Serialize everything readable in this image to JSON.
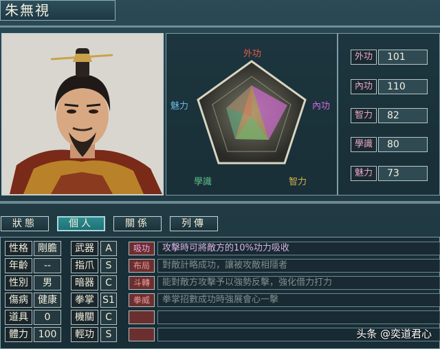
{
  "character": {
    "name": "朱無視"
  },
  "radar": {
    "axes": [
      "外功",
      "內功",
      "智力",
      "學識",
      "魅力"
    ],
    "axis_colors": [
      "#e85a4a",
      "#d56be0",
      "#d6b24a",
      "#5fbf8a",
      "#6cb9e2"
    ]
  },
  "stats": [
    {
      "label": "外功",
      "value": "101"
    },
    {
      "label": "內功",
      "value": "110"
    },
    {
      "label": "智力",
      "value": "82"
    },
    {
      "label": "學識",
      "value": "80"
    },
    {
      "label": "魅力",
      "value": "73"
    }
  ],
  "tabs": [
    "狀態",
    "個人",
    "關係",
    "列傳"
  ],
  "info": {
    "rows": [
      {
        "label": "性格",
        "value": "剛膽",
        "slot": "武器",
        "rank": "A"
      },
      {
        "label": "年齡",
        "value": "--",
        "slot": "指爪",
        "rank": "S"
      },
      {
        "label": "性別",
        "value": "男",
        "slot": "暗器",
        "rank": "C"
      },
      {
        "label": "傷病",
        "value": "健康",
        "slot": "拳掌",
        "rank": "S1"
      },
      {
        "label": "道具",
        "value": "0",
        "slot": "機關",
        "rank": "C"
      },
      {
        "label": "體力",
        "value": "100",
        "slot": "輕功",
        "rank": "S"
      }
    ]
  },
  "skills": [
    {
      "name": "吸功",
      "desc": "攻擊時可將敵方的10%功力吸收",
      "bright": true
    },
    {
      "name": "布局",
      "desc": "對敵計略成功，讓被攻敵相隱者",
      "bright": false
    },
    {
      "name": "斗轉",
      "desc": "能對敵方攻擊予以強勢反擊，強化借力打力",
      "bright": false
    },
    {
      "name": "拳威",
      "desc": "拳掌招數成功時強展會心一擊",
      "bright": false
    },
    {
      "name": "",
      "desc": "",
      "bright": false
    },
    {
      "name": "",
      "desc": "",
      "bright": false
    }
  ],
  "watermark": "头条 @奕道君心"
}
